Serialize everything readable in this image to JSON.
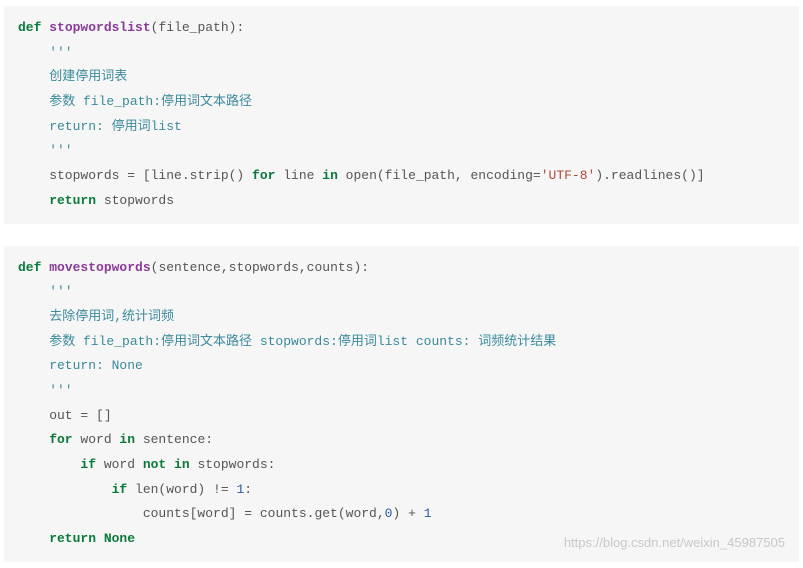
{
  "block1": {
    "l1_def": "def",
    "l1_fn": "stopwordslist",
    "l1_rest": "(file_path):",
    "l2": "    '''",
    "l3": "    创建停用词表",
    "l4": "    参数 file_path:停用词文本路径",
    "l5": "    return: 停用词list",
    "l6": "    '''",
    "l7a": "    stopwords = [line.strip() ",
    "l7_for": "for",
    "l7b": " line ",
    "l7_in": "in",
    "l7c": " open(file_path, encoding=",
    "l7_str": "'UTF-8'",
    "l7d": ").readlines()]",
    "l8_ret": "    return",
    "l8b": " stopwords"
  },
  "block2": {
    "l1_def": "def",
    "l1_fn": "movestopwords",
    "l1_rest": "(sentence,stopwords,counts):",
    "l2": "    '''",
    "l3": "    去除停用词,统计词频",
    "l4": "    参数 file_path:停用词文本路径 stopwords:停用词list counts: 词频统计结果",
    "l5": "    return: None",
    "l6": "    '''",
    "l7": "    out = []",
    "l8_for": "    for",
    "l8a": " word ",
    "l8_in": "in",
    "l8b": " sentence:",
    "l9_if": "        if",
    "l9a": " word ",
    "l9_not": "not in",
    "l9b": " stopwords:",
    "l10_if": "            if",
    "l10a": " len(word) != ",
    "l10_num": "1",
    "l10b": ":",
    "l11a": "                counts[word] = counts.get(word,",
    "l11_num0": "0",
    "l11b": ") + ",
    "l11_num1": "1",
    "l12_ret": "    return",
    "l12_none": " None"
  },
  "watermark": "https://blog.csdn.net/weixin_45987505"
}
